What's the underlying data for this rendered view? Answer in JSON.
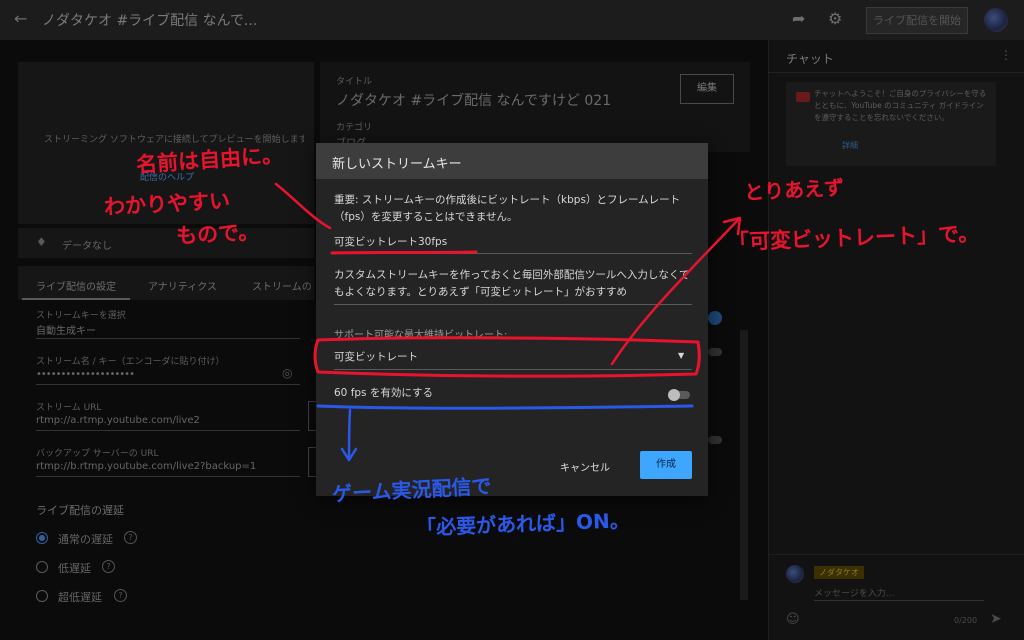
{
  "header": {
    "title": "ノダタケオ #ライブ配信 なんで...",
    "golive_label": "ライブ配信を開始"
  },
  "preview": {
    "hint": "ストリーミング ソフトウェアに接続してプレビューを開始します",
    "link": "配信のヘルプ",
    "data_label": "データなし"
  },
  "info": {
    "title_label": "タイトル",
    "title_value": "ノダタケオ #ライブ配信 なんですけど 021",
    "edit_label": "編集",
    "category_label": "カテゴリ",
    "category_value": "ブログ"
  },
  "tabs": [
    "ライブ配信の設定",
    "アナリティクス",
    "ストリームの状"
  ],
  "settings": {
    "key_select_label": "ストリームキーを選択",
    "key_select_value": "自動生成キー",
    "key_name_label": "ストリーム名 / キー（エンコーダに貼り付け）",
    "key_name_value": "••••••••••••••••••••",
    "url_label": "ストリーム URL",
    "url_value": "rtmp://a.rtmp.youtube.com/live2",
    "backup_label": "バックアップ サーバーの URL",
    "backup_value": "rtmp://b.rtmp.youtube.com/live2?backup=1",
    "latency_title": "ライブ配信の遅延",
    "latency_options": [
      "通常の遅延",
      "低遅延",
      "超低遅延"
    ],
    "qmark": "?"
  },
  "chat": {
    "title": "チャット",
    "welcome": "チャットへようこそ！ご自身のプライバシーを守るとともに、YouTube のコミュニティ ガイドラインを遵守することを忘れないでください。",
    "more_label": "詳細",
    "user_name": "ノダタケオ",
    "input_placeholder": "メッセージを入力...",
    "counter": "0/200"
  },
  "dialog": {
    "title": "新しいストリームキー",
    "notice": "重要: ストリームキーの作成後にビットレート（kbps）とフレームレート（fps）を変更することはできません。",
    "name_value": "可変ビットレート30fps",
    "description_value": "カスタムストリームキーを作っておくと毎回外部配信ツールへ入力しなくてもよくなります。とりあえず「可変ビットレート」がおすすめ",
    "bitrate_label": "サポート可能な最大維持ビットレート:",
    "bitrate_value": "可変ビットレート",
    "fps_label": "60 fps を有効にする",
    "cancel_label": "キャンセル",
    "create_label": "作成"
  },
  "annotations": {
    "name_note_1": "名前は自由に。",
    "name_note_2": "わかりやすい",
    "name_note_3": "もので。",
    "bitrate_note_1": "とりあえず",
    "bitrate_note_2": "「可変ビットレート」で。",
    "fps_note_1": "ゲーム実況配信で",
    "fps_note_2": "「必要があれば」ON。"
  },
  "colors": {
    "annotation_red": "#e8142e",
    "annotation_blue": "#2a58e8",
    "create_button": "#3ea6ff"
  }
}
